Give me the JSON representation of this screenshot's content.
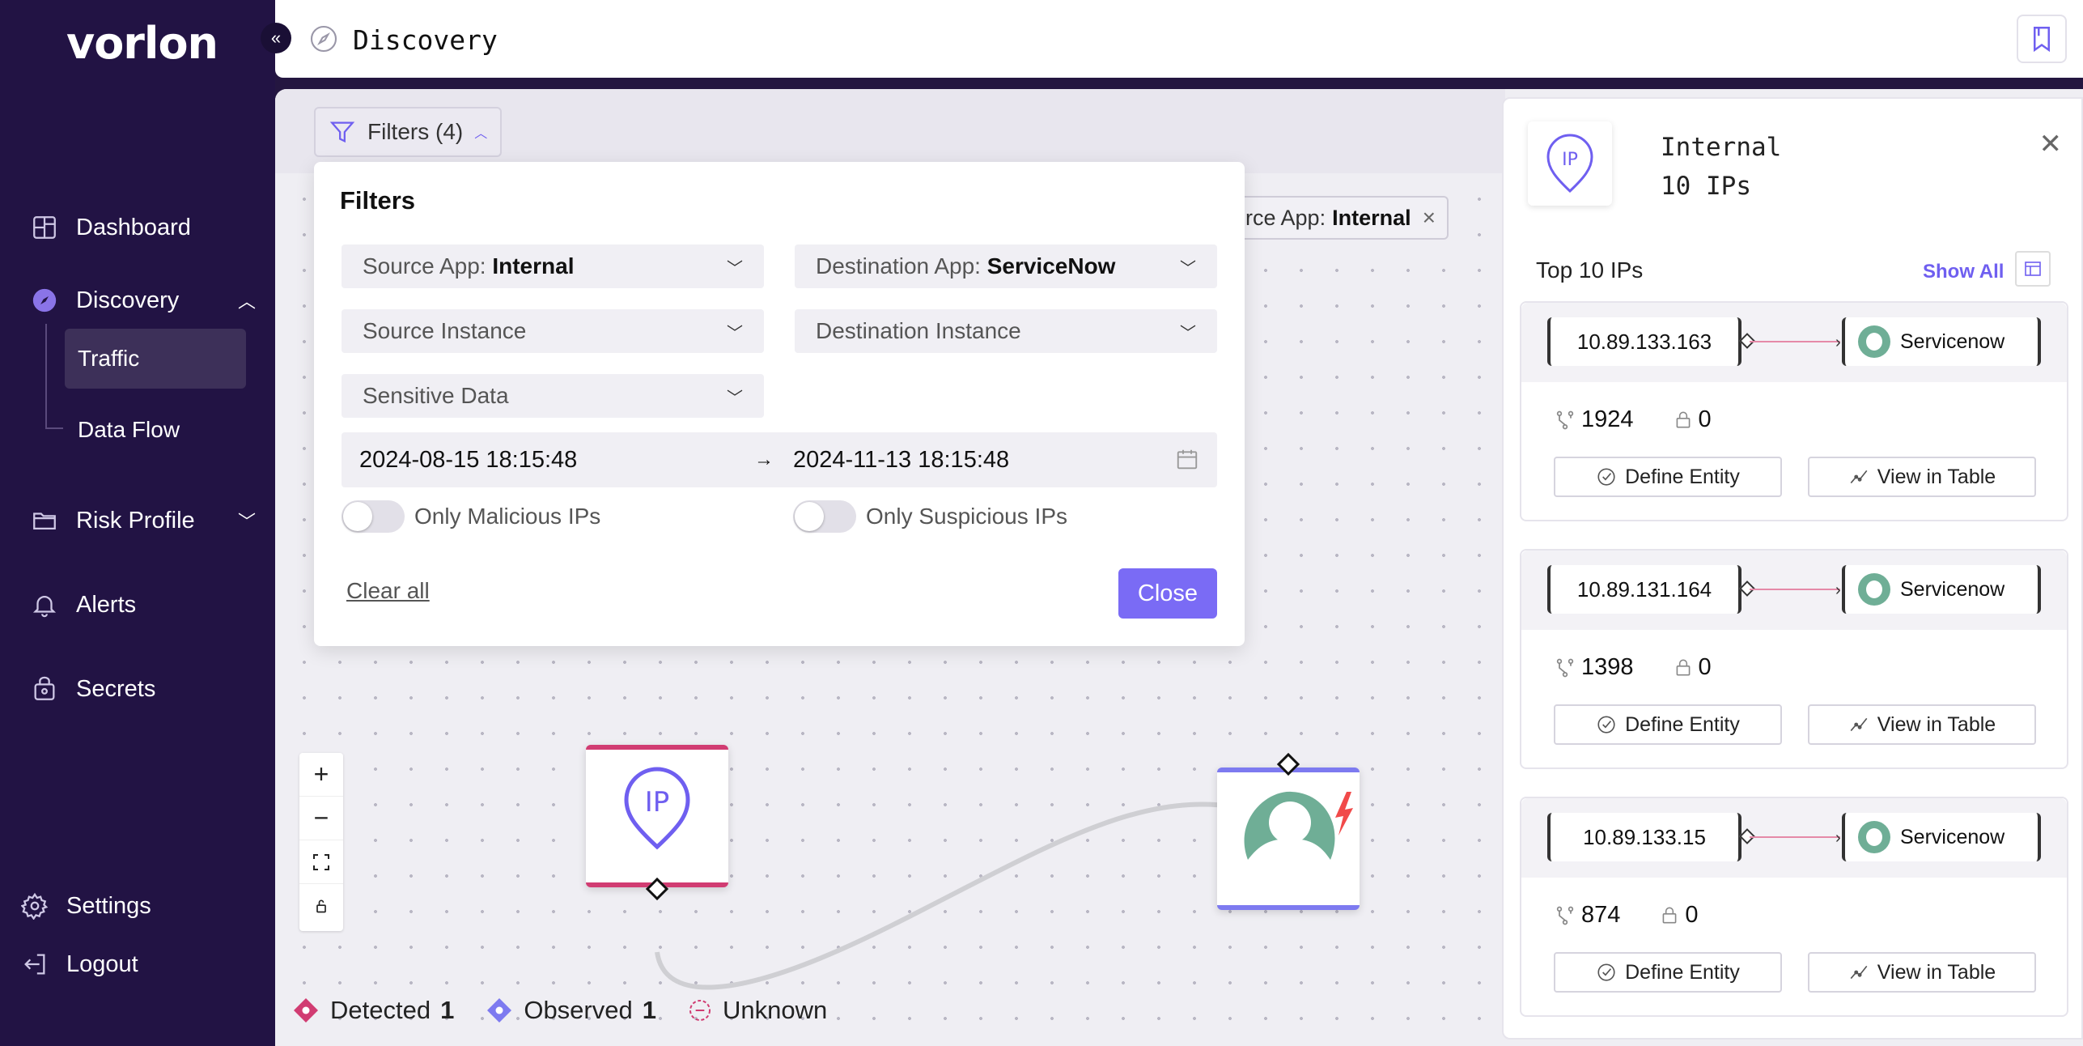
{
  "app": {
    "logo": "vorlon",
    "collapse_glyph": "«"
  },
  "sidebar": {
    "items": [
      {
        "label": "Dashboard",
        "icon": "dashboard-icon"
      },
      {
        "label": "Discovery",
        "icon": "compass-icon",
        "expanded": true,
        "children": [
          {
            "label": "Traffic",
            "active": true
          },
          {
            "label": "Data Flow"
          }
        ]
      },
      {
        "label": "Risk Profile",
        "icon": "folder-icon"
      },
      {
        "label": "Alerts",
        "icon": "bell-icon"
      },
      {
        "label": "Secrets",
        "icon": "lock-bag-icon"
      }
    ],
    "bottom": [
      {
        "label": "Settings",
        "icon": "gear-icon"
      },
      {
        "label": "Logout",
        "icon": "logout-icon"
      }
    ]
  },
  "header": {
    "title": "Discovery"
  },
  "toolbar": {
    "filters_label": "Filters (4)",
    "chip_key": "urce App:",
    "chip_value": "Internal"
  },
  "filters_popup": {
    "title": "Filters",
    "source_app_key": "Source App:",
    "source_app_value": "Internal",
    "dest_app_key": "Destination App:",
    "dest_app_value": "ServiceNow",
    "source_instance": "Source Instance",
    "dest_instance": "Destination Instance",
    "sensitive_data": "Sensitive Data",
    "date_from": "2024-08-15 18:15:48",
    "date_to": "2024-11-13 18:15:48",
    "date_arrow": "→",
    "only_malicious": "Only Malicious IPs",
    "only_suspicious": "Only Suspicious IPs",
    "clear_all": "Clear all",
    "close": "Close"
  },
  "zoom": {
    "plus": "+",
    "minus": "−"
  },
  "legend": {
    "detected_label": "Detected",
    "detected_count": "1",
    "observed_label": "Observed",
    "observed_count": "1",
    "unknown_label": "Unknown"
  },
  "panel": {
    "name": "Internal",
    "count": "10 IPs",
    "section_title": "Top 10 IPs",
    "show_all": "Show All",
    "cards": [
      {
        "ip": "10.89.133.163",
        "dest": "Servicenow",
        "connections": "1924",
        "secrets": "0",
        "define": "Define Entity",
        "view": "View in Table"
      },
      {
        "ip": "10.89.131.164",
        "dest": "Servicenow",
        "connections": "1398",
        "secrets": "0",
        "define": "Define Entity",
        "view": "View in Table"
      },
      {
        "ip": "10.89.133.15",
        "dest": "Servicenow",
        "connections": "874",
        "secrets": "0",
        "define": "Define Entity",
        "view": "View in Table"
      }
    ]
  },
  "colors": {
    "sidebar_bg": "#221344",
    "accent": "#7a6bf5",
    "detected": "#d13c72",
    "observed": "#7d7af0",
    "servicenow": "#6fae96"
  }
}
